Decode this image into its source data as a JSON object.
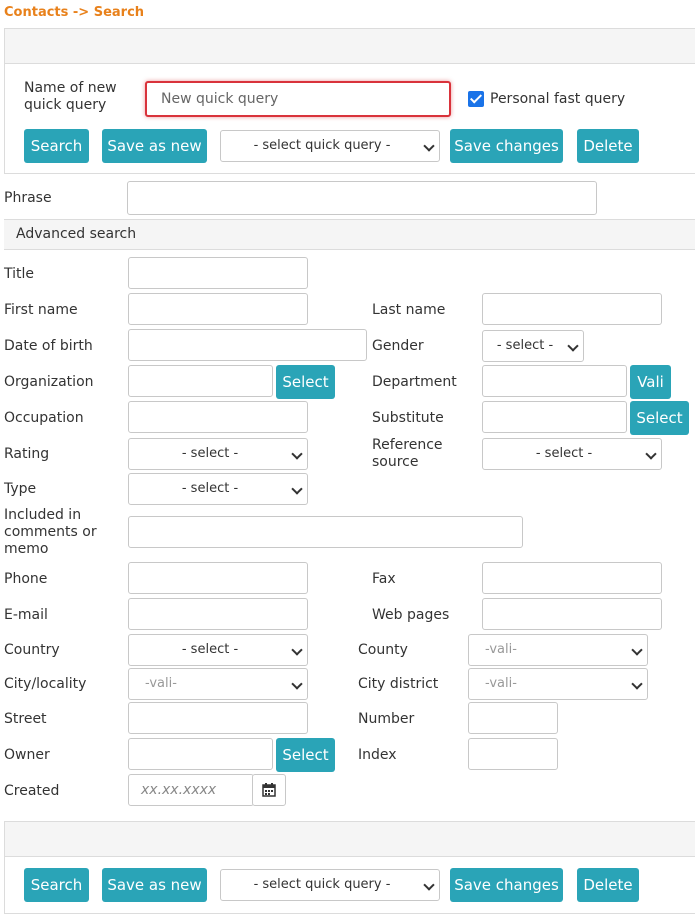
{
  "breadcrumb": "Contacts -> Search",
  "top_panel": {
    "name_label": "Name of new quick query",
    "name_placeholder": "New quick query",
    "personal_label": "Personal fast query",
    "personal_checked": true
  },
  "toolbar": {
    "search": "Search",
    "save_as_new": "Save as new",
    "quick_query_select": "- select quick query -",
    "save_changes": "Save changes",
    "delete": "Delete"
  },
  "phrase_label": "Phrase",
  "advanced_title": "Advanced search",
  "fields": {
    "title": "Title",
    "first_name": "First name",
    "last_name": "Last name",
    "date_of_birth": "Date of birth",
    "gender": "Gender",
    "gender_select": "- select -",
    "organization": "Organization",
    "organization_btn": "Select",
    "department": "Department",
    "department_btn": "Vali",
    "occupation": "Occupation",
    "substitute": "Substitute",
    "substitute_btn": "Select",
    "rating": "Rating",
    "rating_select": "- select -",
    "reference_source": "Reference source",
    "reference_select": "- select -",
    "type": "Type",
    "type_select": "- select -",
    "included": "Included in comments or memo",
    "phone": "Phone",
    "fax": "Fax",
    "email": "E-mail",
    "web_pages": "Web pages",
    "country": "Country",
    "country_select": "- select -",
    "county": "County",
    "county_select": "-vali-",
    "city": "City/locality",
    "city_select": "-vali-",
    "city_district": "City district",
    "city_district_select": "-vali-",
    "street": "Street",
    "number": "Number",
    "owner": "Owner",
    "owner_btn": "Select",
    "index": "Index",
    "created": "Created",
    "created_placeholder": "xx.xx.xxxx"
  },
  "colors": {
    "accent": "#2aa4b7",
    "breadcrumb": "#e8811b",
    "focus": "#d9333b",
    "checkbox": "#1a73e8"
  }
}
